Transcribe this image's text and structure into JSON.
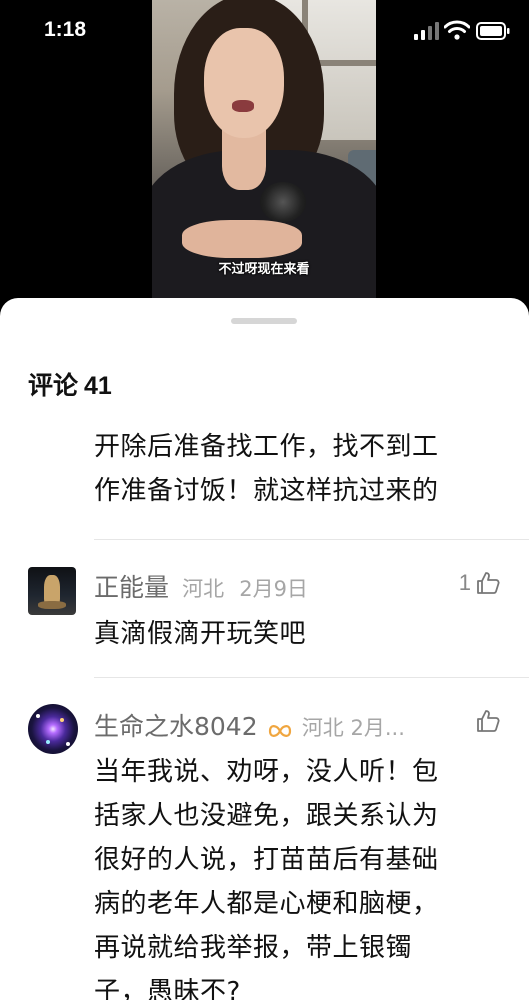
{
  "status_bar": {
    "time": "1:18"
  },
  "video": {
    "subtitle": "不过呀现在来看"
  },
  "sheet": {
    "title": "评论",
    "count": "41"
  },
  "comments": [
    {
      "text_lines": [
        "开除后准备找工作，找不到工",
        "作准备讨饭！就这样抗过来的"
      ]
    },
    {
      "user": "正能量",
      "location": "河北",
      "date": "2月9日",
      "likes": "1",
      "text": "真滴假滴开玩笑吧",
      "avatar_icon": "buddha-statue-avatar"
    },
    {
      "user": "生命之水8042",
      "location_date": "河北 2月...",
      "likes": "",
      "avatar_icon": "galaxy-avatar",
      "badge_icon": "infinity-badge-icon",
      "text_lines": [
        "当年我说、劝呀，没人听！包",
        "括家人也没避免，跟关系认为",
        "很好的人说，打苗苗后有基础",
        "病的老年人都是心梗和脑梗，",
        "再说就给我举报，带上银镯",
        "子，愚昧不?"
      ]
    }
  ],
  "colors": {
    "accent_badge": "#f0a640",
    "text": "#111111",
    "meta": "#a6a6a6"
  }
}
